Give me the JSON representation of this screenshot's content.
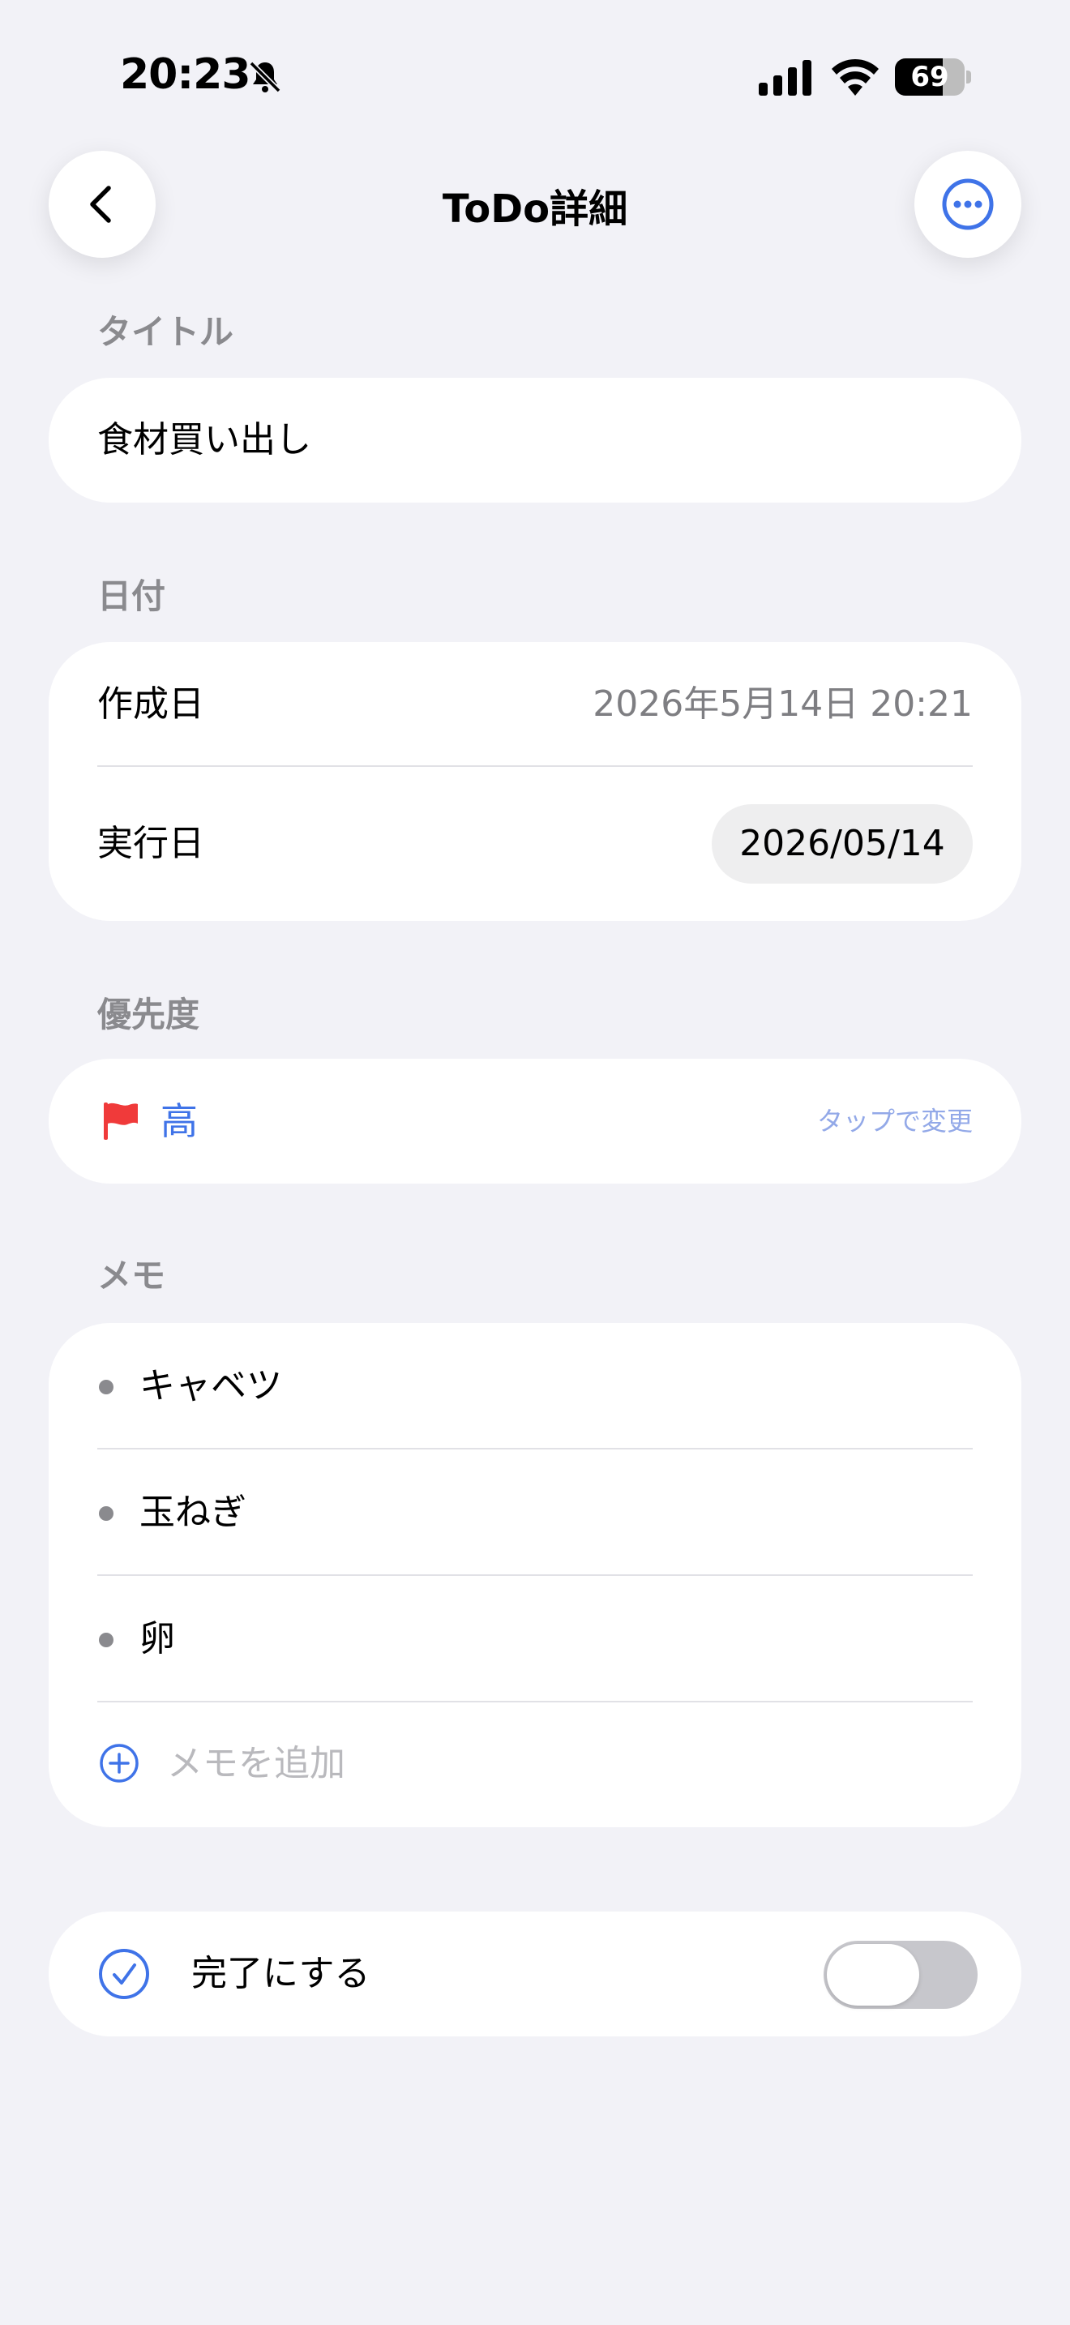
{
  "status_bar": {
    "time": "20:23",
    "battery": "69",
    "battery_level": 0.69,
    "icons": [
      "bell-slash-icon",
      "cellular-signal-icon",
      "wifi-icon",
      "battery-icon"
    ]
  },
  "nav": {
    "title": "ToDo詳細",
    "back_icon": "chevron-left-icon",
    "more_icon": "ellipsis-circle-icon"
  },
  "title_section": {
    "label": "タイトル",
    "value": "食材買い出し"
  },
  "date_section": {
    "label": "日付",
    "created_label": "作成日",
    "created_value": "2026年5月14日 20:21",
    "execution_label": "実行日",
    "execution_value": "2026/05/14"
  },
  "priority_section": {
    "label": "優先度",
    "value": "高",
    "hint": "タップで変更",
    "flag_color": "#f03a3a"
  },
  "memo_section": {
    "label": "メモ",
    "items": [
      "キャベツ",
      "玉ねぎ",
      "卵"
    ],
    "add_placeholder": "メモを追加"
  },
  "complete": {
    "label": "完了にする",
    "toggle_on": false
  },
  "colors": {
    "accent": "#3f73e8",
    "background": "#f2f2f7",
    "secondary_text": "#8a8a8e"
  }
}
